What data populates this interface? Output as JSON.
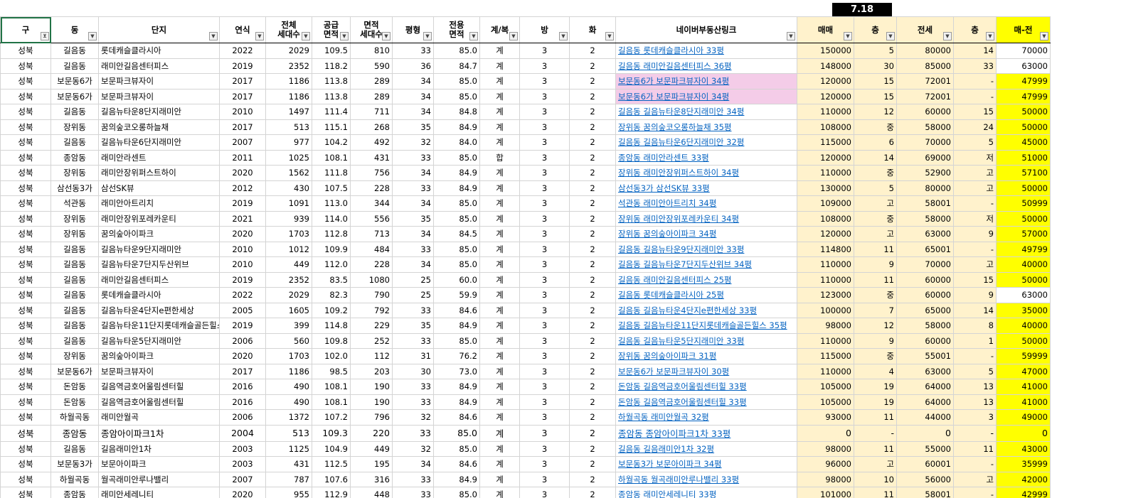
{
  "date_label": "7.18",
  "columns": [
    "구",
    "동",
    "단지",
    "연식",
    "전체\n세대수",
    "공급\n면적",
    "면적\n세대수",
    "평형",
    "전용\n면적",
    "계/복",
    "방",
    "화",
    "네이버부동산링크",
    "매매",
    "층",
    "전세",
    "층",
    "매-전"
  ],
  "rows": [
    [
      "성북",
      "길음동",
      "롯데캐슬클라시아",
      "2022",
      "2029",
      "109.5",
      "810",
      "33",
      "85.0",
      "계",
      "3",
      "2",
      "길음동 롯데캐슬클라시아 33평",
      "150000",
      "5",
      "80000",
      "14",
      "70000"
    ],
    [
      "성북",
      "길음동",
      "래미안길음센터피스",
      "2019",
      "2352",
      "118.2",
      "590",
      "36",
      "84.7",
      "계",
      "3",
      "2",
      "길음동 래미안길음센터피스 36평",
      "148000",
      "30",
      "85000",
      "33",
      "63000"
    ],
    [
      "성북",
      "보문동6가",
      "보문파크뷰자이",
      "2017",
      "1186",
      "113.8",
      "289",
      "34",
      "85.0",
      "계",
      "3",
      "2",
      "보문동6가 보문파크뷰자이 34평",
      "120000",
      "15",
      "72001",
      "-",
      "47999"
    ],
    [
      "성북",
      "보문동6가",
      "보문파크뷰자이",
      "2017",
      "1186",
      "113.8",
      "289",
      "34",
      "85.0",
      "계",
      "3",
      "2",
      "보문동6가 보문파크뷰자이 34평",
      "120000",
      "15",
      "72001",
      "-",
      "47999"
    ],
    [
      "성북",
      "길음동",
      "길음뉴타운8단지래미안",
      "2010",
      "1497",
      "111.4",
      "711",
      "34",
      "84.8",
      "계",
      "3",
      "2",
      "길음동 길음뉴타운8단지래미안 34평",
      "110000",
      "12",
      "60000",
      "15",
      "50000"
    ],
    [
      "성북",
      "장위동",
      "꿈의숲코오롱하늘채",
      "2017",
      "513",
      "115.1",
      "268",
      "35",
      "84.9",
      "계",
      "3",
      "2",
      "장위동 꿈의숲코오롱하늘채 35평",
      "108000",
      "중",
      "58000",
      "24",
      "50000"
    ],
    [
      "성북",
      "길음동",
      "길음뉴타운6단지래미안",
      "2007",
      "977",
      "104.2",
      "492",
      "32",
      "84.0",
      "계",
      "3",
      "2",
      "길음동 길음뉴타운6단지래미안 32평",
      "115000",
      "6",
      "70000",
      "5",
      "45000"
    ],
    [
      "성북",
      "종암동",
      "래미안라센트",
      "2011",
      "1025",
      "108.1",
      "431",
      "33",
      "85.0",
      "합",
      "3",
      "2",
      "종암동 래미안라센트 33평",
      "120000",
      "14",
      "69000",
      "저",
      "51000"
    ],
    [
      "성북",
      "장위동",
      "래미안장위퍼스트하이",
      "2020",
      "1562",
      "111.8",
      "756",
      "34",
      "84.9",
      "계",
      "3",
      "2",
      "장위동 래미안장위퍼스트하이 34평",
      "110000",
      "중",
      "52900",
      "고",
      "57100"
    ],
    [
      "성북",
      "삼선동3가",
      "삼선SK뷰",
      "2012",
      "430",
      "107.5",
      "228",
      "33",
      "84.9",
      "계",
      "3",
      "2",
      "삼선동3가 삼선SK뷰 33평",
      "130000",
      "5",
      "80000",
      "고",
      "50000"
    ],
    [
      "성북",
      "석관동",
      "래미안아트리치",
      "2019",
      "1091",
      "113.0",
      "344",
      "34",
      "85.0",
      "계",
      "3",
      "2",
      "석관동 래미안아트리치 34평",
      "109000",
      "고",
      "58001",
      "-",
      "50999"
    ],
    [
      "성북",
      "장위동",
      "래미안장위포레카운티",
      "2021",
      "939",
      "114.0",
      "556",
      "35",
      "85.0",
      "계",
      "3",
      "2",
      "장위동 래미안장위포레카운티 34평",
      "108000",
      "중",
      "58000",
      "저",
      "50000"
    ],
    [
      "성북",
      "장위동",
      "꿈의숲아이파크",
      "2020",
      "1703",
      "112.8",
      "713",
      "34",
      "84.5",
      "계",
      "3",
      "2",
      "장위동 꿈의숲아이파크 34평",
      "120000",
      "고",
      "63000",
      "9",
      "57000"
    ],
    [
      "성북",
      "길음동",
      "길음뉴타운9단지래미안",
      "2010",
      "1012",
      "109.9",
      "484",
      "33",
      "85.0",
      "계",
      "3",
      "2",
      "길음동 길음뉴타운9단지래미안 33평",
      "114800",
      "11",
      "65001",
      "-",
      "49799"
    ],
    [
      "성북",
      "길음동",
      "길음뉴타운7단지두산위브",
      "2010",
      "449",
      "112.0",
      "228",
      "34",
      "85.0",
      "계",
      "3",
      "2",
      "길음동 길음뉴타운7단지두산위브 34평",
      "110000",
      "9",
      "70000",
      "고",
      "40000"
    ],
    [
      "성북",
      "길음동",
      "래미안길음센터피스",
      "2019",
      "2352",
      "83.5",
      "1080",
      "25",
      "60.0",
      "계",
      "3",
      "2",
      "길음동 래미안길음센터피스 25평",
      "110000",
      "11",
      "60000",
      "15",
      "50000"
    ],
    [
      "성북",
      "길음동",
      "롯데캐슬클라시아",
      "2022",
      "2029",
      "82.3",
      "790",
      "25",
      "59.9",
      "계",
      "3",
      "2",
      "길음동 롯데캐슬클라시아 25평",
      "123000",
      "중",
      "60000",
      "9",
      "63000"
    ],
    [
      "성북",
      "길음동",
      "길음뉴타운4단지e편한세상",
      "2005",
      "1605",
      "109.2",
      "792",
      "33",
      "84.6",
      "계",
      "3",
      "2",
      "길음동 길음뉴타운4단지e편한세상 33평",
      "100000",
      "7",
      "65000",
      "14",
      "35000"
    ],
    [
      "성북",
      "길음동",
      "길음뉴타운11단지롯데캐슬골든힐스",
      "2019",
      "399",
      "114.8",
      "229",
      "35",
      "84.9",
      "계",
      "3",
      "2",
      "길음동 길음뉴타운11단지롯데캐슬골든힐스 35평",
      "98000",
      "12",
      "58000",
      "8",
      "40000"
    ],
    [
      "성북",
      "길음동",
      "길음뉴타운5단지래미안",
      "2006",
      "560",
      "109.8",
      "252",
      "33",
      "85.0",
      "계",
      "3",
      "2",
      "길음동 길음뉴타운5단지래미안 33평",
      "110000",
      "9",
      "60000",
      "1",
      "50000"
    ],
    [
      "성북",
      "장위동",
      "꿈의숲아이파크",
      "2020",
      "1703",
      "102.0",
      "112",
      "31",
      "76.2",
      "계",
      "3",
      "2",
      "장위동 꿈의숲아이파크 31평",
      "115000",
      "중",
      "55001",
      "-",
      "59999"
    ],
    [
      "성북",
      "보문동6가",
      "보문파크뷰자이",
      "2017",
      "1186",
      "98.5",
      "203",
      "30",
      "73.0",
      "계",
      "3",
      "2",
      "보문동6가 보문파크뷰자이 30평",
      "110000",
      "4",
      "63000",
      "5",
      "47000"
    ],
    [
      "성북",
      "돈암동",
      "길음역금호어울림센터힐",
      "2016",
      "490",
      "108.1",
      "190",
      "33",
      "84.9",
      "계",
      "3",
      "2",
      "돈암동 길음역금호어울림센터힐 33평",
      "105000",
      "19",
      "64000",
      "13",
      "41000"
    ],
    [
      "성북",
      "돈암동",
      "길음역금호어울림센터힐",
      "2016",
      "490",
      "108.1",
      "190",
      "33",
      "84.9",
      "계",
      "3",
      "2",
      "돈암동 길음역금호어울림센터힐 33평",
      "105000",
      "19",
      "64000",
      "13",
      "41000"
    ],
    [
      "성북",
      "하월곡동",
      "래미안월곡",
      "2006",
      "1372",
      "107.2",
      "796",
      "32",
      "84.6",
      "계",
      "3",
      "2",
      "하월곡동 래미안월곡 32평",
      "93000",
      "11",
      "44000",
      "3",
      "49000"
    ],
    [
      "성북",
      "종암동",
      "종암아이파크1차",
      "2004",
      "513",
      "109.3",
      "220",
      "33",
      "85.0",
      "계",
      "3",
      "2",
      "종암동 종암아이파크1차 33평",
      "0",
      "-",
      "0",
      "-",
      "0"
    ],
    [
      "성북",
      "길음동",
      "길음래미안1차",
      "2003",
      "1125",
      "104.9",
      "449",
      "32",
      "85.0",
      "계",
      "3",
      "2",
      "길음동 길음래미안1차 32평",
      "98000",
      "11",
      "55000",
      "11",
      "43000"
    ],
    [
      "성북",
      "보문동3가",
      "보문아이파크",
      "2003",
      "431",
      "112.5",
      "195",
      "34",
      "84.6",
      "계",
      "3",
      "2",
      "보문동3가 보문아이파크 34평",
      "96000",
      "고",
      "60001",
      "-",
      "35999"
    ],
    [
      "성북",
      "하월곡동",
      "월곡래미안루나밸리",
      "2007",
      "787",
      "107.6",
      "316",
      "33",
      "84.9",
      "계",
      "3",
      "2",
      "하월곡동 월곡래미안루나밸리 33평",
      "98000",
      "10",
      "56000",
      "고",
      "42000"
    ],
    [
      "성북",
      "종암동",
      "래미안세레니티",
      "2020",
      "955",
      "112.9",
      "448",
      "33",
      "85.0",
      "계",
      "3",
      "2",
      "종암동 래미안세레니티 33평",
      "101000",
      "11",
      "58001",
      "-",
      "42999"
    ]
  ]
}
